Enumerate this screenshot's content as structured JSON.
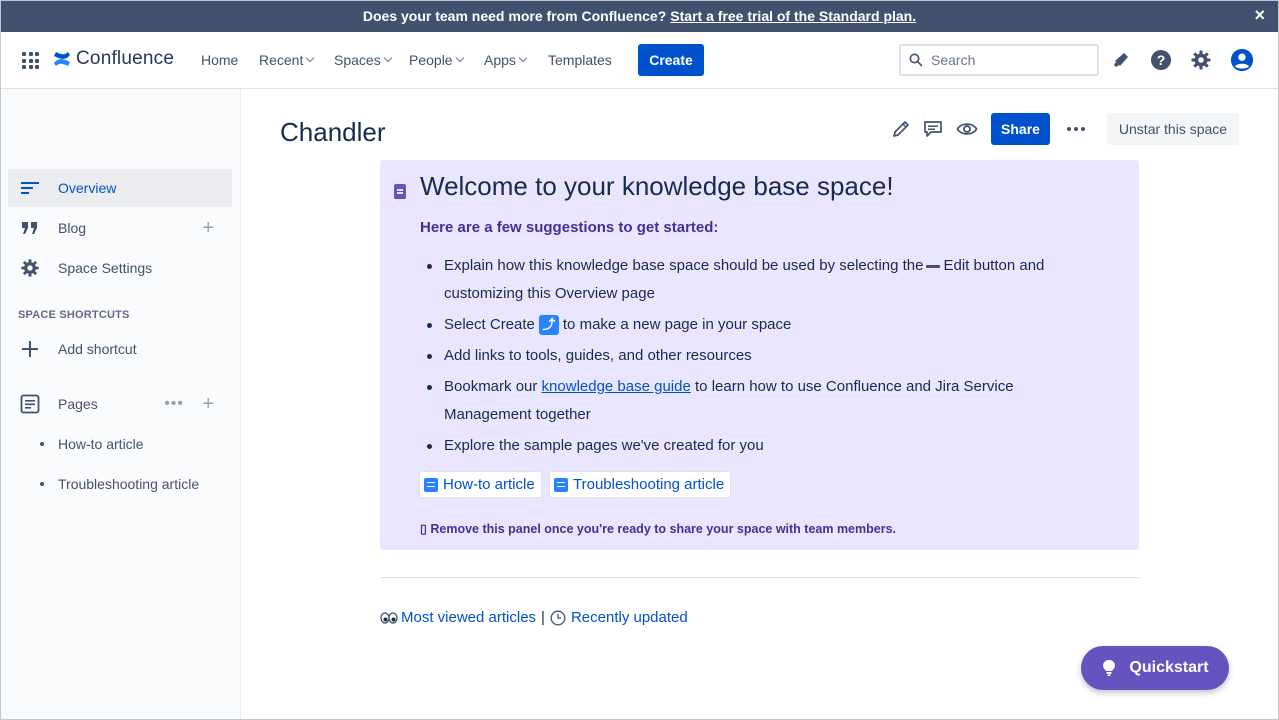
{
  "banner": {
    "text": "Does your team need more from Confluence?",
    "link": "Start a free trial of the Standard plan.",
    "close": "×"
  },
  "nav": {
    "logo": "Confluence",
    "items": [
      "Home",
      "Recent",
      "Spaces",
      "People",
      "Apps",
      "Templates"
    ],
    "create": "Create",
    "search_placeholder": "Search"
  },
  "sidebar": {
    "overview": "Overview",
    "blog": "Blog",
    "settings": "Space Settings",
    "shortcuts_heading": "SPACE SHORTCUTS",
    "add_shortcut": "Add shortcut",
    "pages": "Pages",
    "page_children": [
      "How-to article",
      "Troubleshooting article"
    ]
  },
  "header": {
    "space_title": "Chandler",
    "share": "Share",
    "unstar": "Unstar this space"
  },
  "panel": {
    "title": "Welcome to your knowledge base space!",
    "subtitle": "Here are a few suggestions to get started:",
    "b1_pre": "Explain how this knowledge base space should be used by selecting the",
    "b1_post": "Edit button and customizing this Overview page",
    "b2_pre": "Select Create",
    "b2_post": "to make a new page in your space",
    "b3": "Add links to tools, guides, and other resources",
    "b4_pre": "Bookmark our",
    "b4_link": "knowledge base guide",
    "b4_post": "to learn how to use Confluence and Jira Service Management together",
    "b5": "Explore the sample pages we've created for you",
    "chip1": "How-to article",
    "chip2": "Troubleshooting article",
    "remove_note": "Remove this panel once you're ready to share your space with team members."
  },
  "footer_links": {
    "most_viewed": "Most viewed articles",
    "separator": "|",
    "recently_updated": "Recently updated"
  },
  "quickstart": "Quickstart",
  "colors": {
    "banner": "#42526e",
    "primary": "#0052cc",
    "panel": "#eae6ff",
    "quickstart": "#6554c0"
  }
}
